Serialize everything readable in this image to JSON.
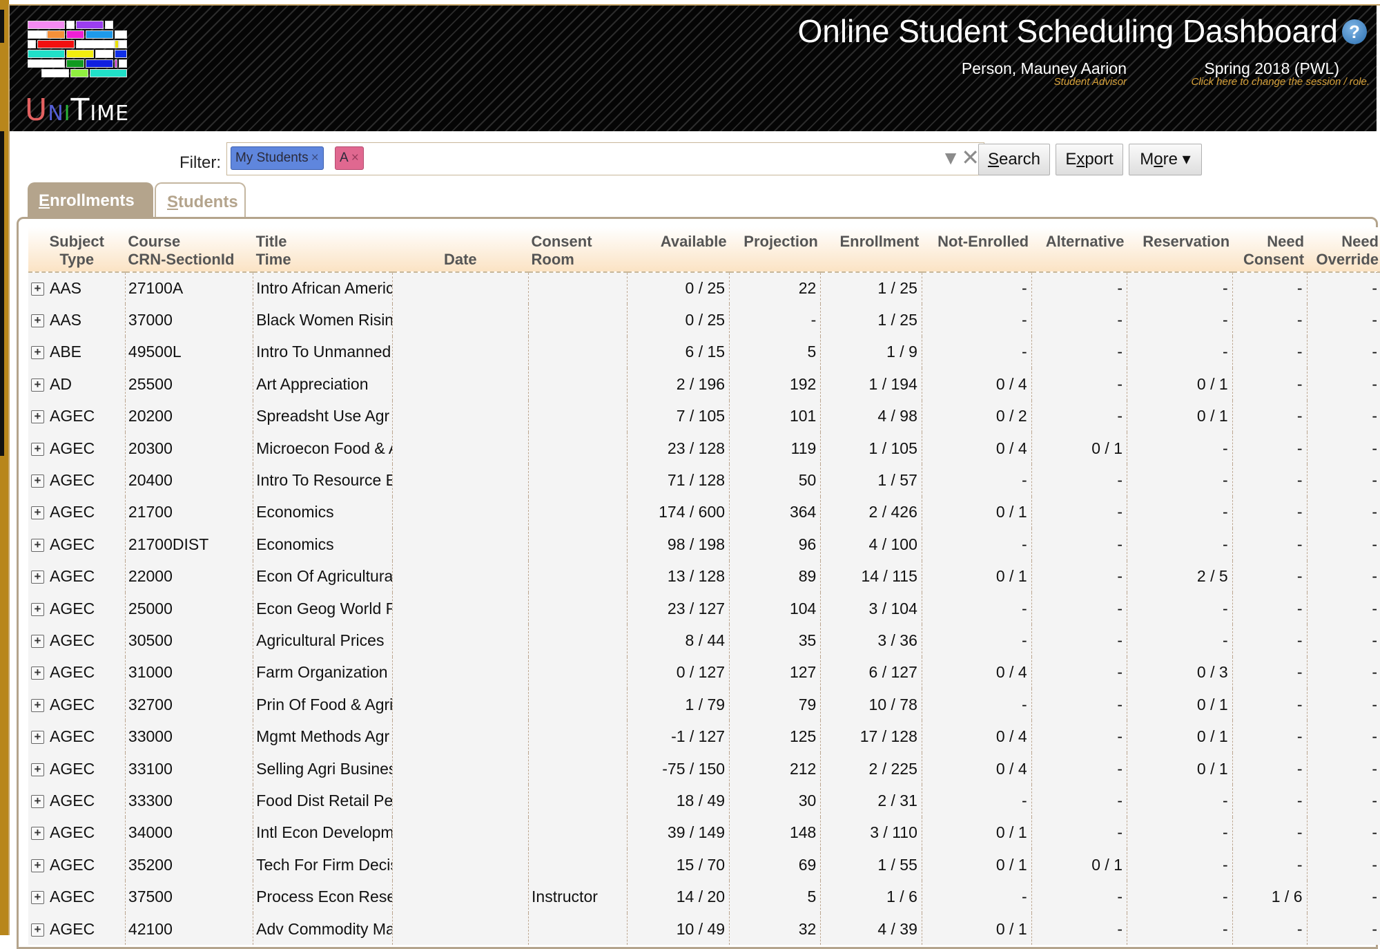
{
  "header": {
    "logo_text": {
      "u": "U",
      "n": "N",
      "i": "I",
      "t": "T",
      "me": "IME"
    },
    "title": "Online Student Scheduling Dashboard",
    "help_icon": "question-mark-icon",
    "user_name": "Person, Mauney Aarion",
    "user_role": "Student Advisor",
    "session_name": "Spring 2018 (PWL)",
    "session_hint": "Click here to change the session / role."
  },
  "filter": {
    "label": "Filter:",
    "chips": [
      {
        "label": "My Students",
        "color": "#5f86dd"
      },
      {
        "label": "A",
        "color": "#e06890"
      }
    ],
    "chip_remove_glyph": "×",
    "dropdown_glyph": "▼",
    "clear_glyph": "✕",
    "search_button": {
      "accel": "S",
      "rest": "earch"
    },
    "export_button": {
      "pre": "E",
      "accel": "x",
      "rest": "port"
    },
    "more_button": {
      "pre": "M",
      "accel": "o",
      "rest": "re ▾"
    }
  },
  "tabs": [
    {
      "accel": "E",
      "rest": "nrollments",
      "active": true
    },
    {
      "accel": "S",
      "rest": "tudents",
      "active": false
    }
  ],
  "table": {
    "headers": {
      "subject": [
        "Subject",
        "Type"
      ],
      "course": [
        "Course",
        "CRN-SectionId"
      ],
      "title": [
        "Title",
        "Time"
      ],
      "date": [
        "",
        "Date"
      ],
      "consent": [
        "Consent",
        "Room"
      ],
      "available": [
        "Available",
        ""
      ],
      "projection": [
        "Projection",
        ""
      ],
      "enrollment": [
        "Enrollment",
        ""
      ],
      "not_enrolled": [
        "Not-Enrolled",
        ""
      ],
      "alternative": [
        "Alternative",
        ""
      ],
      "reservation": [
        "Reservation",
        ""
      ],
      "need_consent": [
        "Need",
        "Consent"
      ],
      "need_override": [
        "Need",
        "Override"
      ]
    },
    "rows": [
      {
        "subject": "AAS",
        "course": "27100A",
        "title": "Intro African American Studies",
        "consent": "",
        "available": "0 / 25",
        "projection": "22",
        "enrollment": "1 / 25",
        "not_enrolled": "-",
        "alternative": "-",
        "reservation": "-",
        "need_consent": "-",
        "need_override": "-"
      },
      {
        "subject": "AAS",
        "course": "37000",
        "title": "Black Women Rising",
        "consent": "",
        "available": "0 / 25",
        "projection": "-",
        "enrollment": "1 / 25",
        "not_enrolled": "-",
        "alternative": "-",
        "reservation": "-",
        "need_consent": "-",
        "need_override": "-"
      },
      {
        "subject": "ABE",
        "course": "49500L",
        "title": "Intro To Unmanned Aircraft Sys",
        "consent": "",
        "available": "6 / 15",
        "projection": "5",
        "enrollment": "1 / 9",
        "not_enrolled": "-",
        "alternative": "-",
        "reservation": "-",
        "need_consent": "-",
        "need_override": "-"
      },
      {
        "subject": "AD",
        "course": "25500",
        "title": "Art Appreciation",
        "consent": "",
        "available": "2 / 196",
        "projection": "192",
        "enrollment": "1 / 194",
        "not_enrolled": "0 / 4",
        "alternative": "-",
        "reservation": "0 / 1",
        "need_consent": "-",
        "need_override": "-"
      },
      {
        "subject": "AGEC",
        "course": "20200",
        "title": "Spreadsht Use Agr Bus",
        "consent": "",
        "available": "7 / 105",
        "projection": "101",
        "enrollment": "4 / 98",
        "not_enrolled": "0 / 2",
        "alternative": "-",
        "reservation": "0 / 1",
        "need_consent": "-",
        "need_override": "-"
      },
      {
        "subject": "AGEC",
        "course": "20300",
        "title": "Microecon Food & Agbus",
        "consent": "",
        "available": "23 / 128",
        "projection": "119",
        "enrollment": "1 / 105",
        "not_enrolled": "0 / 4",
        "alternative": "0 / 1",
        "reservation": "-",
        "need_consent": "-",
        "need_override": "-"
      },
      {
        "subject": "AGEC",
        "course": "20400",
        "title": "Intro To Resource Econ",
        "consent": "",
        "available": "71 / 128",
        "projection": "50",
        "enrollment": "1 / 57",
        "not_enrolled": "-",
        "alternative": "-",
        "reservation": "-",
        "need_consent": "-",
        "need_override": "-"
      },
      {
        "subject": "AGEC",
        "course": "21700",
        "title": "Economics",
        "consent": "",
        "available": "174 / 600",
        "projection": "364",
        "enrollment": "2 / 426",
        "not_enrolled": "0 / 1",
        "alternative": "-",
        "reservation": "-",
        "need_consent": "-",
        "need_override": "-"
      },
      {
        "subject": "AGEC",
        "course": "21700DIST",
        "title": "Economics",
        "consent": "",
        "available": "98 / 198",
        "projection": "96",
        "enrollment": "4 / 100",
        "not_enrolled": "-",
        "alternative": "-",
        "reservation": "-",
        "need_consent": "-",
        "need_override": "-"
      },
      {
        "subject": "AGEC",
        "course": "22000",
        "title": "Econ Of Agricultural Markets",
        "consent": "",
        "available": "13 / 128",
        "projection": "89",
        "enrollment": "14 / 115",
        "not_enrolled": "0 / 1",
        "alternative": "-",
        "reservation": "2 / 5",
        "need_consent": "-",
        "need_override": "-"
      },
      {
        "subject": "AGEC",
        "course": "25000",
        "title": "Econ Geog World Food",
        "consent": "",
        "available": "23 / 127",
        "projection": "104",
        "enrollment": "3 / 104",
        "not_enrolled": "-",
        "alternative": "-",
        "reservation": "-",
        "need_consent": "-",
        "need_override": "-"
      },
      {
        "subject": "AGEC",
        "course": "30500",
        "title": "Agricultural Prices",
        "consent": "",
        "available": "8 / 44",
        "projection": "35",
        "enrollment": "3 / 36",
        "not_enrolled": "-",
        "alternative": "-",
        "reservation": "-",
        "need_consent": "-",
        "need_override": "-"
      },
      {
        "subject": "AGEC",
        "course": "31000",
        "title": "Farm Organization",
        "consent": "",
        "available": "0 / 127",
        "projection": "127",
        "enrollment": "6 / 127",
        "not_enrolled": "0 / 4",
        "alternative": "-",
        "reservation": "0 / 3",
        "need_consent": "-",
        "need_override": "-"
      },
      {
        "subject": "AGEC",
        "course": "32700",
        "title": "Prin Of Food & Agribus Mrkt",
        "consent": "",
        "available": "1 / 79",
        "projection": "79",
        "enrollment": "10 / 78",
        "not_enrolled": "-",
        "alternative": "-",
        "reservation": "0 / 1",
        "need_consent": "-",
        "need_override": "-"
      },
      {
        "subject": "AGEC",
        "course": "33000",
        "title": "Mgmt Methods Agr Bus",
        "consent": "",
        "available": "-1 / 127",
        "projection": "125",
        "enrollment": "17 / 128",
        "not_enrolled": "0 / 4",
        "alternative": "-",
        "reservation": "0 / 1",
        "need_consent": "-",
        "need_override": "-"
      },
      {
        "subject": "AGEC",
        "course": "33100",
        "title": "Selling Agri Business",
        "consent": "",
        "available": "-75 / 150",
        "projection": "212",
        "enrollment": "2 / 225",
        "not_enrolled": "0 / 4",
        "alternative": "-",
        "reservation": "0 / 1",
        "need_consent": "-",
        "need_override": "-"
      },
      {
        "subject": "AGEC",
        "course": "33300",
        "title": "Food Dist Retail Persp",
        "consent": "",
        "available": "18 / 49",
        "projection": "30",
        "enrollment": "2 / 31",
        "not_enrolled": "-",
        "alternative": "-",
        "reservation": "-",
        "need_consent": "-",
        "need_override": "-"
      },
      {
        "subject": "AGEC",
        "course": "34000",
        "title": "Intl Econ Development",
        "consent": "",
        "available": "39 / 149",
        "projection": "148",
        "enrollment": "3 / 110",
        "not_enrolled": "0 / 1",
        "alternative": "-",
        "reservation": "-",
        "need_consent": "-",
        "need_override": "-"
      },
      {
        "subject": "AGEC",
        "course": "35200",
        "title": "Tech For Firm Decision",
        "consent": "",
        "available": "15 / 70",
        "projection": "69",
        "enrollment": "1 / 55",
        "not_enrolled": "0 / 1",
        "alternative": "0 / 1",
        "reservation": "-",
        "need_consent": "-",
        "need_override": "-"
      },
      {
        "subject": "AGEC",
        "course": "37500",
        "title": "Process Econ Research",
        "consent": "Instructor",
        "available": "14 / 20",
        "projection": "5",
        "enrollment": "1 / 6",
        "not_enrolled": "-",
        "alternative": "-",
        "reservation": "-",
        "need_consent": "1 / 6",
        "need_override": "-"
      },
      {
        "subject": "AGEC",
        "course": "42100",
        "title": "Adv Commodity Marketing",
        "consent": "",
        "available": "10 / 49",
        "projection": "32",
        "enrollment": "4 / 39",
        "not_enrolled": "0 / 1",
        "alternative": "-",
        "reservation": "-",
        "need_consent": "-",
        "need_override": "-"
      }
    ]
  }
}
